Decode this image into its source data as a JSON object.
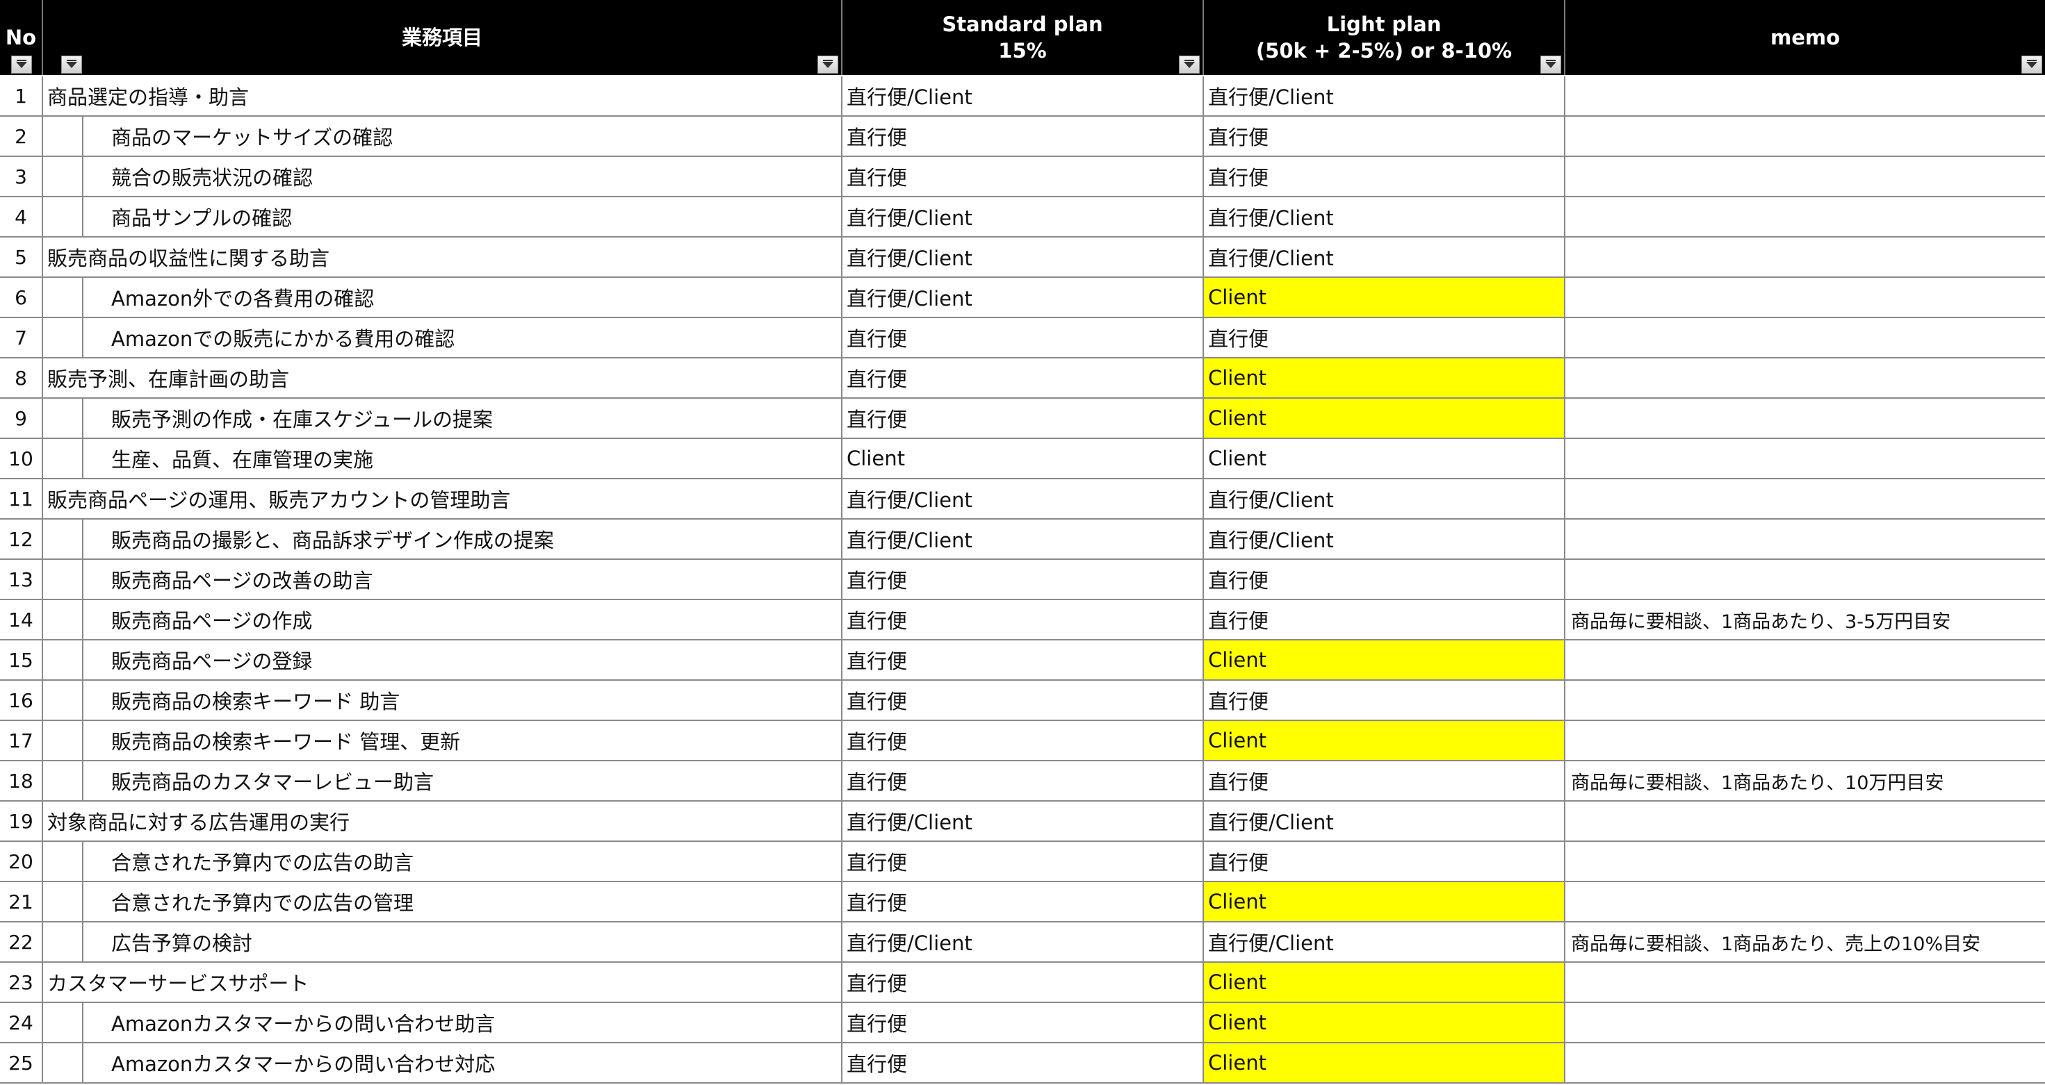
{
  "header": {
    "no": "No",
    "task": "業務項目",
    "standard": "Standard plan\n15%",
    "light": "Light plan\n(50k + 2-5%) or 8-10%",
    "memo": "memo"
  },
  "colors": {
    "header_bg": "#000000",
    "highlight": "#ffff00",
    "grid": "#8a8a8a"
  },
  "rows": [
    {
      "no": "1",
      "task": "商品選定の指導・助言",
      "sub": false,
      "standard": "直行便/Client",
      "light": "直行便/Client",
      "light_hl": false,
      "memo": ""
    },
    {
      "no": "2",
      "task": "商品のマーケットサイズの確認",
      "sub": true,
      "standard": "直行便",
      "light": "直行便",
      "light_hl": false,
      "memo": ""
    },
    {
      "no": "3",
      "task": "競合の販売状況の確認",
      "sub": true,
      "standard": "直行便",
      "light": "直行便",
      "light_hl": false,
      "memo": ""
    },
    {
      "no": "4",
      "task": "商品サンプルの確認",
      "sub": true,
      "standard": "直行便/Client",
      "light": "直行便/Client",
      "light_hl": false,
      "memo": ""
    },
    {
      "no": "5",
      "task": "販売商品の収益性に関する助言",
      "sub": false,
      "standard": "直行便/Client",
      "light": "直行便/Client",
      "light_hl": false,
      "memo": ""
    },
    {
      "no": "6",
      "task": "Amazon外での各費用の確認",
      "sub": true,
      "standard": "直行便/Client",
      "light": "Client",
      "light_hl": true,
      "memo": ""
    },
    {
      "no": "7",
      "task": "Amazonでの販売にかかる費用の確認",
      "sub": true,
      "standard": "直行便",
      "light": "直行便",
      "light_hl": false,
      "memo": ""
    },
    {
      "no": "8",
      "task": "販売予測、在庫計画の助言",
      "sub": false,
      "standard": "直行便",
      "light": "Client",
      "light_hl": true,
      "memo": ""
    },
    {
      "no": "9",
      "task": "販売予測の作成・在庫スケジュールの提案",
      "sub": true,
      "standard": "直行便",
      "light": "Client",
      "light_hl": true,
      "memo": ""
    },
    {
      "no": "10",
      "task": "生産、品質、在庫管理の実施",
      "sub": true,
      "standard": "Client",
      "light": "Client",
      "light_hl": false,
      "memo": ""
    },
    {
      "no": "11",
      "task": "販売商品ページの運用、販売アカウントの管理助言",
      "sub": false,
      "standard": "直行便/Client",
      "light": "直行便/Client",
      "light_hl": false,
      "memo": ""
    },
    {
      "no": "12",
      "task": "販売商品の撮影と、商品訴求デザイン作成の提案",
      "sub": true,
      "standard": "直行便/Client",
      "light": "直行便/Client",
      "light_hl": false,
      "memo": ""
    },
    {
      "no": "13",
      "task": "販売商品ページの改善の助言",
      "sub": true,
      "standard": "直行便",
      "light": "直行便",
      "light_hl": false,
      "memo": ""
    },
    {
      "no": "14",
      "task": "販売商品ページの作成",
      "sub": true,
      "standard": "直行便",
      "light": "直行便",
      "light_hl": false,
      "memo": "商品毎に要相談、1商品あたり、3-5万円目安"
    },
    {
      "no": "15",
      "task": "販売商品ページの登録",
      "sub": true,
      "standard": "直行便",
      "light": "Client",
      "light_hl": true,
      "memo": ""
    },
    {
      "no": "16",
      "task": "販売商品の検索キーワード 助言",
      "sub": true,
      "standard": "直行便",
      "light": "直行便",
      "light_hl": false,
      "memo": ""
    },
    {
      "no": "17",
      "task": "販売商品の検索キーワード 管理、更新",
      "sub": true,
      "standard": "直行便",
      "light": "Client",
      "light_hl": true,
      "memo": ""
    },
    {
      "no": "18",
      "task": "販売商品のカスタマーレビュー助言",
      "sub": true,
      "standard": "直行便",
      "light": "直行便",
      "light_hl": false,
      "memo": "商品毎に要相談、1商品あたり、10万円目安"
    },
    {
      "no": "19",
      "task": "対象商品に対する広告運用の実行",
      "sub": false,
      "standard": "直行便/Client",
      "light": "直行便/Client",
      "light_hl": false,
      "memo": ""
    },
    {
      "no": "20",
      "task": "合意された予算内での広告の助言",
      "sub": true,
      "standard": "直行便",
      "light": "直行便",
      "light_hl": false,
      "memo": ""
    },
    {
      "no": "21",
      "task": "合意された予算内での広告の管理",
      "sub": true,
      "standard": "直行便",
      "light": "Client",
      "light_hl": true,
      "memo": ""
    },
    {
      "no": "22",
      "task": "広告予算の検討",
      "sub": true,
      "standard": "直行便/Client",
      "light": "直行便/Client",
      "light_hl": false,
      "memo": "商品毎に要相談、1商品あたり、売上の10%目安"
    },
    {
      "no": "23",
      "task": "カスタマーサービスサポート",
      "sub": false,
      "standard": "直行便",
      "light": "Client",
      "light_hl": true,
      "memo": ""
    },
    {
      "no": "24",
      "task": "Amazonカスタマーからの問い合わせ助言",
      "sub": true,
      "standard": "直行便",
      "light": "Client",
      "light_hl": true,
      "memo": ""
    },
    {
      "no": "25",
      "task": "Amazonカスタマーからの問い合わせ対応",
      "sub": true,
      "standard": "直行便",
      "light": "Client",
      "light_hl": true,
      "memo": ""
    }
  ]
}
